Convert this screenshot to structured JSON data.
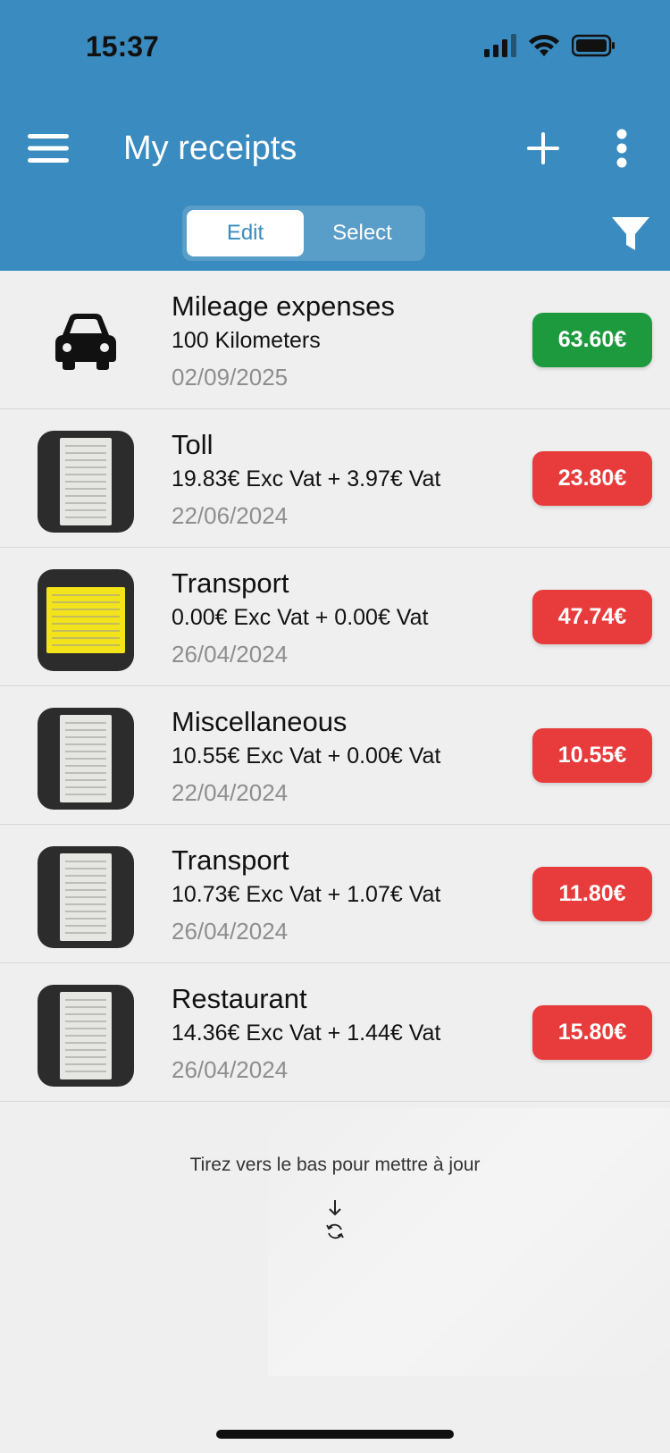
{
  "status": {
    "time": "15:37"
  },
  "header": {
    "title": "My receipts",
    "segments": [
      {
        "label": "Edit",
        "active": true
      },
      {
        "label": "Select",
        "active": false
      }
    ]
  },
  "receipts": [
    {
      "title": "Mileage expenses",
      "subtitle": "100 Kilometers",
      "date": "02/09/2025",
      "amount": "63.60€",
      "status_color": "#1d9a3e",
      "thumbnail": "car-icon"
    },
    {
      "title": "Toll",
      "subtitle": "19.83€ Exc Vat + 3.97€ Vat",
      "date": "22/06/2024",
      "amount": "23.80€",
      "status_color": "#e83b3b",
      "thumbnail": "receipt-photo"
    },
    {
      "title": "Transport",
      "subtitle": "0.00€ Exc Vat + 0.00€ Vat",
      "date": "26/04/2024",
      "amount": "47.74€",
      "status_color": "#e83b3b",
      "thumbnail": "receipt-photo-yellow"
    },
    {
      "title": "Miscellaneous",
      "subtitle": "10.55€ Exc Vat + 0.00€ Vat",
      "date": "22/04/2024",
      "amount": "10.55€",
      "status_color": "#e83b3b",
      "thumbnail": "receipt-photo"
    },
    {
      "title": "Transport",
      "subtitle": "10.73€ Exc Vat + 1.07€ Vat",
      "date": "26/04/2024",
      "amount": "11.80€",
      "status_color": "#e83b3b",
      "thumbnail": "receipt-photo"
    },
    {
      "title": "Restaurant",
      "subtitle": "14.36€ Exc Vat + 1.44€ Vat",
      "date": "26/04/2024",
      "amount": "15.80€",
      "status_color": "#e83b3b",
      "thumbnail": "receipt-photo"
    }
  ],
  "footer": {
    "pull_hint": "Tirez vers le bas pour mettre à jour"
  },
  "colors": {
    "header": "#3a8bbf",
    "positive": "#1d9a3e",
    "negative": "#e83b3b"
  }
}
